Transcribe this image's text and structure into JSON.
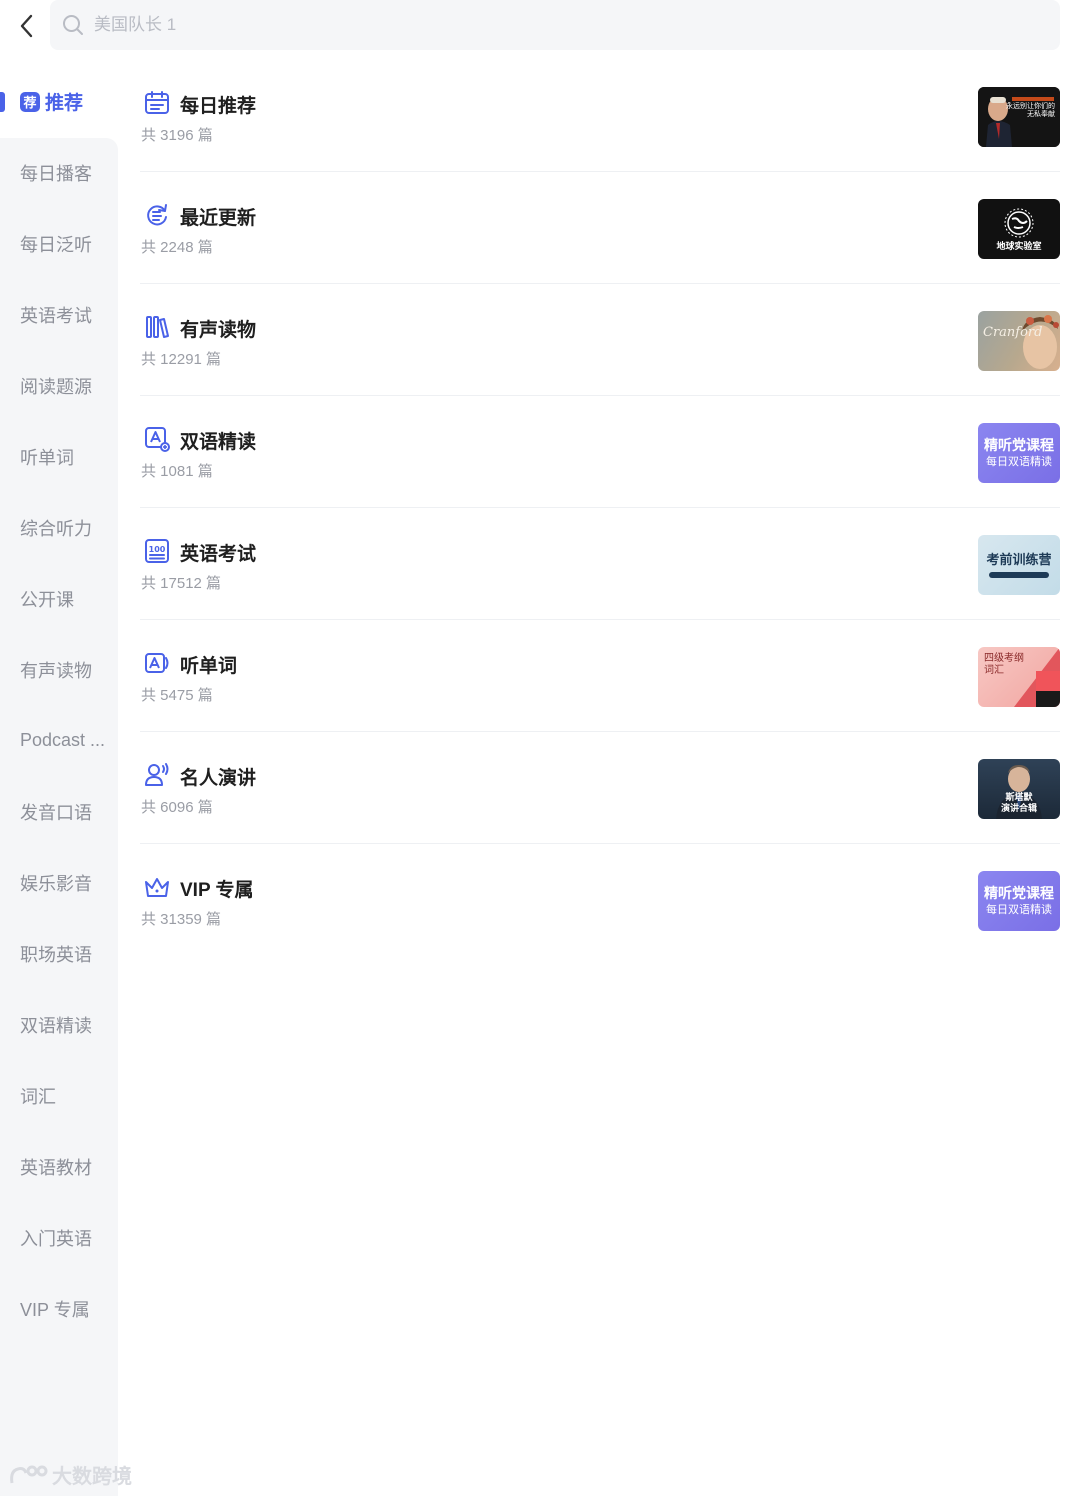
{
  "search": {
    "placeholder": "美国队长 1"
  },
  "sidebar": {
    "items": [
      {
        "label": "推荐",
        "badge": "荐",
        "active": true
      },
      {
        "label": "每日播客"
      },
      {
        "label": "每日泛听"
      },
      {
        "label": "英语考试"
      },
      {
        "label": "阅读题源"
      },
      {
        "label": "听单词"
      },
      {
        "label": "综合听力"
      },
      {
        "label": "公开课"
      },
      {
        "label": "有声读物"
      },
      {
        "label": "Podcast ..."
      },
      {
        "label": "发音口语"
      },
      {
        "label": "娱乐影音"
      },
      {
        "label": "职场英语"
      },
      {
        "label": "双语精读"
      },
      {
        "label": "词汇"
      },
      {
        "label": "英语教材"
      },
      {
        "label": "入门英语"
      },
      {
        "label": "VIP 专属"
      }
    ]
  },
  "categories": [
    {
      "title": "每日推荐",
      "count": "共 3196 篇",
      "icon": "calendar-icon",
      "thumb_text": [
        "永远别让你们的",
        "无私奉献"
      ]
    },
    {
      "title": "最近更新",
      "count": "共 2248 篇",
      "icon": "refresh-icon",
      "thumb_text": [
        "地球实验室"
      ]
    },
    {
      "title": "有声读物",
      "count": "共 12291 篇",
      "icon": "books-icon",
      "thumb_text": [
        "Cranford"
      ]
    },
    {
      "title": "双语精读",
      "count": "共 1081 篇",
      "icon": "translate-icon",
      "thumb_text": [
        "精听党课程",
        "每日双语精读"
      ]
    },
    {
      "title": "英语考试",
      "count": "共 17512 篇",
      "icon": "score-100-icon",
      "thumb_text": [
        "考前训练营"
      ]
    },
    {
      "title": "听单词",
      "count": "共 5475 篇",
      "icon": "word-audio-icon",
      "thumb_text": [
        "四级考纲",
        "词汇"
      ]
    },
    {
      "title": "名人演讲",
      "count": "共 6096 篇",
      "icon": "speaker-person-icon",
      "thumb_text": [
        "斯塔默",
        "演讲合辑"
      ]
    },
    {
      "title": "VIP 专属",
      "count": "共 31359 篇",
      "icon": "crown-icon",
      "thumb_text": [
        "精听党课程",
        "每日双语精读"
      ]
    }
  ],
  "watermark": "大数跨境",
  "colors": {
    "accent": "#4a62e8",
    "sidebar_bg": "#f5f6f8",
    "muted_text": "#8d9099"
  }
}
